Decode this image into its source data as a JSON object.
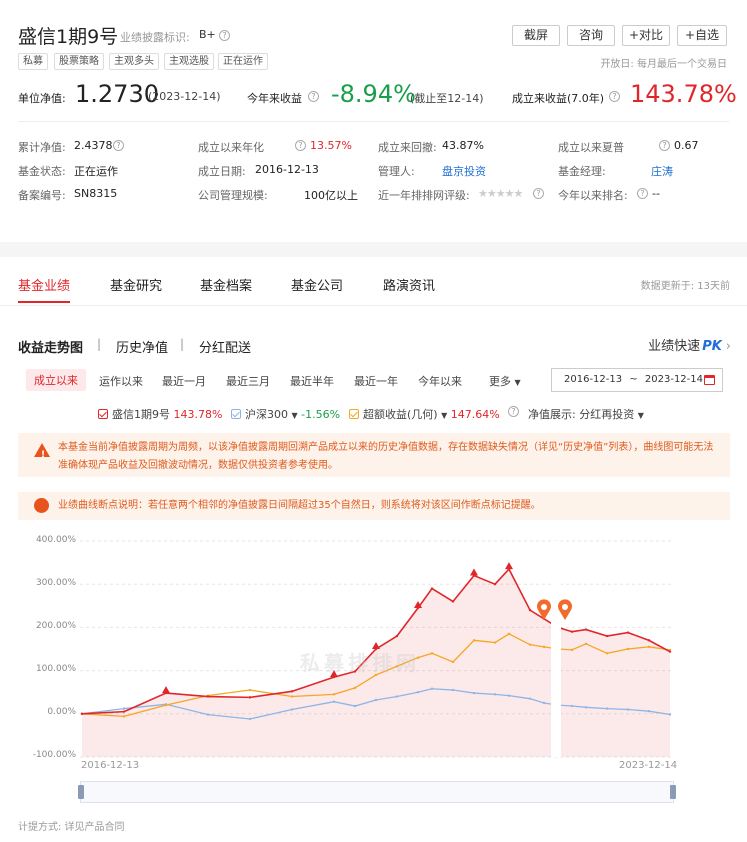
{
  "fund": {
    "name": "盛信1期9号",
    "disclosure_label": "业绩披露标识:",
    "disclosure_value": "B+",
    "tags": [
      "私募",
      "股票策略",
      "主观多头",
      "主观选股",
      "正在运作"
    ],
    "open_day": "开放日: 每月最后一个交易日",
    "buttons": {
      "screenshot": "截屏",
      "consult": "咨询",
      "compare": "+对比",
      "watch": "+自选"
    },
    "nav_label": "单位净值:",
    "nav_value": "1.2730",
    "nav_date": "(2023-12-14)",
    "ytd_label": "今年来收益",
    "ytd_value": "-8.94%",
    "ytd_date": "(截止至12-14)",
    "since_label": "成立来收益(7.0年)",
    "since_value": "143.78%"
  },
  "info": [
    {
      "label": "累计净值:",
      "value": "2.4378",
      "q": true
    },
    {
      "label": "成立以来年化",
      "value": "13.57%",
      "q": true,
      "color": "red"
    },
    {
      "label": "成立来回撤:",
      "value": "43.87%"
    },
    {
      "label": "成立以来夏普",
      "value": "0.67",
      "q": true
    },
    {
      "label": "基金状态:",
      "value": "正在运作"
    },
    {
      "label": "成立日期:",
      "value": "2016-12-13"
    },
    {
      "label": "管理人:",
      "value": "盘京投资",
      "color": "blue"
    },
    {
      "label": "基金经理:",
      "value": "庄涛",
      "color": "blue"
    },
    {
      "label": "备案编号:",
      "value": "SN8315"
    },
    {
      "label": "公司管理规模:",
      "value": "100亿以上"
    },
    {
      "label": "近一年排排网评级:",
      "value": "★★★★★",
      "q": true,
      "color": "stars"
    },
    {
      "label": "今年以来排名:",
      "value": "--",
      "q": true
    }
  ],
  "tabs": [
    "基金业绩",
    "基金研究",
    "基金档案",
    "基金公司",
    "路演资讯"
  ],
  "data_update": "数据更新于: 13天前",
  "subtabs": [
    "收益走势图",
    "历史净值",
    "分红配送"
  ],
  "quick_label": "业绩快速",
  "quick_pk": "PK",
  "ranges": [
    "成立以来",
    "运作以来",
    "最近一月",
    "最近三月",
    "最近半年",
    "最近一年",
    "今年以来",
    "更多"
  ],
  "date_from": "2016-12-13",
  "date_sep": "~",
  "date_to": "2023-12-14",
  "legend": [
    {
      "name": "盛信1期9号",
      "value": "143.78%",
      "color": "#e0262a"
    },
    {
      "name": "沪深300",
      "value": "-1.56%",
      "color": "#8fb4e6"
    },
    {
      "name": "超额收益(几何)",
      "value": "147.64%",
      "color": "#f5a623"
    }
  ],
  "nav_display_label": "净值展示:",
  "nav_display_value": "分红再投资",
  "notice1": "本基金当前净值披露周期为周频，以该净值披露周期回溯产品成立以来的历史净值数据，存在数据缺失情况（详见“历史净值”列表），曲线图可能无法准确体现产品收益及回撤波动情况，数据仅供投资者参考使用。",
  "notice2": "业绩曲线断点说明：若任意两个相邻的净值披露日间隔超过35个自然日，则系统将对该区间作断点标记提醒。",
  "watermark": "私募排排网",
  "fee_note": "计提方式: 详见产品合同",
  "colors": {
    "red": "#e0262a",
    "blue": "#1f6fd6",
    "green": "#1a9e4b",
    "accent": "#e0262a"
  },
  "chart_data": {
    "type": "line",
    "y_ticks": [
      "400.00%",
      "300.00%",
      "200.00%",
      "100.00%",
      "0.00%",
      "-100.00%"
    ],
    "ylim": [
      -100,
      400
    ],
    "x_range": [
      "2016-12-13",
      "2023-12-14"
    ],
    "x_tick_labels": [
      "2016-12-13",
      "2023-12-14"
    ],
    "grid": true,
    "series": [
      {
        "name": "盛信1期9号",
        "x": [
          "2016-12",
          "2017-06",
          "2017-12",
          "2018-06",
          "2018-12",
          "2019-06",
          "2019-12",
          "2020-03",
          "2020-06",
          "2020-09",
          "2020-12",
          "2021-02",
          "2021-05",
          "2021-08",
          "2021-11",
          "2022-01",
          "2022-04",
          "2022-06",
          "2022-08",
          "2022-10",
          "2022-12",
          "2023-03",
          "2023-06",
          "2023-09",
          "2023-12"
        ],
        "y": [
          0,
          5,
          48,
          40,
          38,
          52,
          85,
          98,
          150,
          180,
          245,
          290,
          260,
          320,
          300,
          335,
          240,
          220,
          200,
          190,
          195,
          180,
          188,
          170,
          143.78
        ]
      },
      {
        "name": "沪深300",
        "x": [
          "2016-12",
          "2017-06",
          "2017-12",
          "2018-06",
          "2018-12",
          "2019-06",
          "2019-12",
          "2020-03",
          "2020-06",
          "2020-09",
          "2020-12",
          "2021-02",
          "2021-05",
          "2021-08",
          "2021-11",
          "2022-01",
          "2022-04",
          "2022-06",
          "2022-08",
          "2022-10",
          "2022-12",
          "2023-03",
          "2023-06",
          "2023-09",
          "2023-12"
        ],
        "y": [
          0,
          12,
          22,
          -2,
          -12,
          10,
          28,
          18,
          32,
          40,
          50,
          58,
          55,
          48,
          45,
          42,
          35,
          25,
          20,
          18,
          15,
          12,
          10,
          6,
          -1.56
        ]
      },
      {
        "name": "超额收益(几何)",
        "x": [
          "2016-12",
          "2017-06",
          "2017-12",
          "2018-06",
          "2018-12",
          "2019-06",
          "2019-12",
          "2020-03",
          "2020-06",
          "2020-09",
          "2020-12",
          "2021-02",
          "2021-05",
          "2021-08",
          "2021-11",
          "2022-01",
          "2022-04",
          "2022-06",
          "2022-08",
          "2022-10",
          "2022-12",
          "2023-03",
          "2023-06",
          "2023-09",
          "2023-12"
        ],
        "y": [
          0,
          -6,
          20,
          42,
          55,
          40,
          45,
          60,
          90,
          110,
          130,
          140,
          120,
          170,
          165,
          185,
          160,
          155,
          150,
          148,
          162,
          140,
          150,
          155,
          147.64
        ]
      }
    ]
  }
}
